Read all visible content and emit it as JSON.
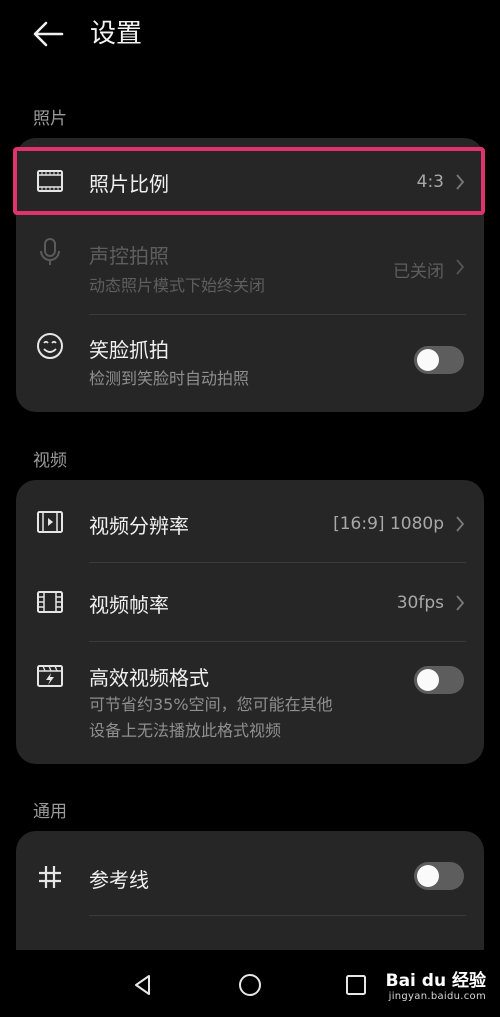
{
  "header": {
    "title": "设置"
  },
  "sections": {
    "photo": {
      "label": "照片",
      "aspect_ratio": {
        "title": "照片比例",
        "value": "4:3"
      },
      "voice_capture": {
        "title": "声控拍照",
        "subtitle": "动态照片模式下始终关闭",
        "value": "已关闭"
      },
      "smile_capture": {
        "title": "笑脸抓拍",
        "subtitle": "检测到笑脸时自动拍照",
        "enabled": false
      }
    },
    "video": {
      "label": "视频",
      "resolution": {
        "title": "视频分辨率",
        "value": "[16:9] 1080p"
      },
      "frame_rate": {
        "title": "视频帧率",
        "value": "30fps"
      },
      "efficient_format": {
        "title": "高效视频格式",
        "subtitle_line1": "可节省约35%空间，您可能在其他",
        "subtitle_line2": "设备上无法播放此格式视频",
        "enabled": false
      }
    },
    "general": {
      "label": "通用",
      "gridlines": {
        "title": "参考线",
        "enabled": false
      }
    }
  },
  "watermark": {
    "brand": "Bai du 经验",
    "url": "jingyan.baidu.com"
  },
  "colors": {
    "background": "#000000",
    "card": "#262626",
    "highlight": "#e0336e"
  },
  "icons": {
    "back": "arrow-left-icon",
    "aspect": "aspect-ratio-icon",
    "mic": "microphone-icon",
    "smile": "smile-face-icon",
    "resolution": "video-resolution-icon",
    "framerate": "film-strip-icon",
    "efficient": "video-efficient-icon",
    "grid": "hash-grid-icon"
  }
}
